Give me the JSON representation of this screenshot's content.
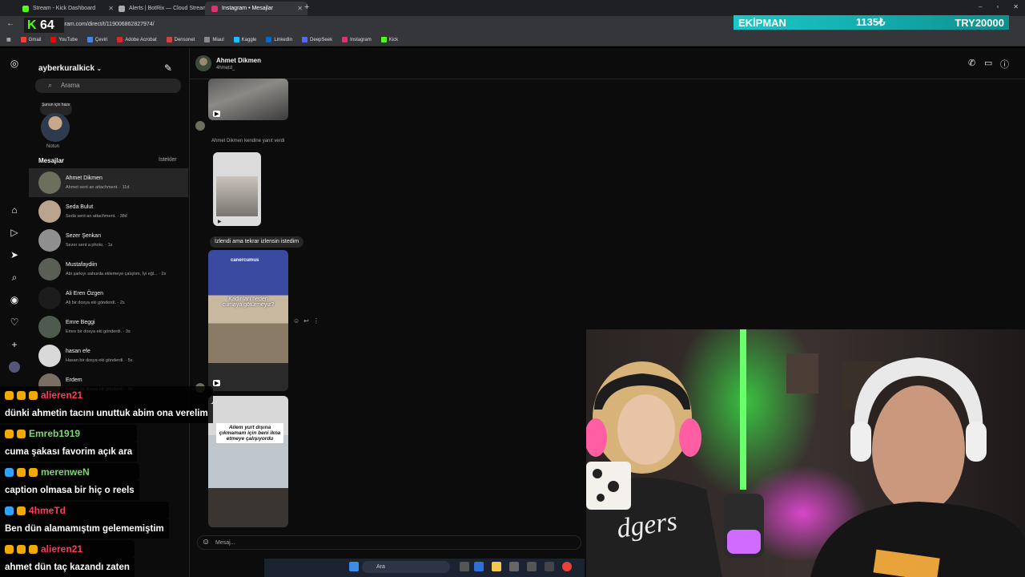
{
  "browser": {
    "tabs": [
      {
        "label": "Stream - Kick Dashboard",
        "color": "#53fc18"
      },
      {
        "label": "Alerts | BotRix — Cloud Stream",
        "color": "#aaaaaa"
      },
      {
        "label": "Instagram • Mesajlar",
        "color": "#e1306c"
      }
    ],
    "url": "instagram.com/direct/t/119006862827974/",
    "bookmarks": [
      "Gmail",
      "YouTube",
      "Çeviri",
      "Adobe Acrobat",
      "Densonet",
      "Miaul",
      "Kaggle",
      "LinkedIn",
      "DeepSeek",
      "Instagram",
      "Kick"
    ],
    "kick_viewers": "64"
  },
  "overlay_bar": {
    "name": "EKİPMAN",
    "amount": "1135₺",
    "goal": "TRY20000"
  },
  "instagram": {
    "username": "ayberkuralkick",
    "search_placeholder": "Arama",
    "note_bubble": "Şunun için hazır",
    "note_label": "Notun",
    "messages_heading": "Mesajlar",
    "requests_link": "İstekler",
    "conversations": [
      {
        "name": "Ahmet Dikmen",
        "preview": "Ahmet sent an attachment. · 11d",
        "active": true,
        "color": "#6b6f5c"
      },
      {
        "name": "Seda Bulut",
        "preview": "Seda sent an attachment. · 38d",
        "active": false,
        "color": "#b9a48e"
      },
      {
        "name": "Sezer Şenkan",
        "preview": "Sezer sent a photo. · 1s",
        "active": false,
        "color": "#8f8f8f"
      },
      {
        "name": "Mustafaydiin",
        "preview": "Abi şarkıyı sahurda eklemeye çalıştım, İyi eğl... · 2s",
        "active": false,
        "color": "#5a5f55"
      },
      {
        "name": "Ali Eren Özgen",
        "preview": "Ali bir dosya eki gönderdi. · 2s",
        "active": false,
        "color": "#1c1c1c"
      },
      {
        "name": "Emre Beggi",
        "preview": "Emre bir dosya eki gönderdi. · 3s",
        "active": false,
        "color": "#4e5a4e"
      },
      {
        "name": "hasan efe",
        "preview": "Hasan bir dosya eki gönderdi. · 5s",
        "active": false,
        "color": "#d9d9d9"
      },
      {
        "name": "Erdem",
        "preview": "Erdem bir dosya eki gönderdi. · 6s",
        "active": false,
        "color": "#7a6f63"
      }
    ],
    "chat": {
      "name": "Ahmet Dikmen",
      "username": "4hmetd_",
      "reply_label": "Ahmet Dikmen kendine yanıt verdi",
      "text_message": "İzlendi ama tekrar izlensin istedim",
      "reel1_user": "canercumus",
      "reel1_caption": "Kadınları neden cumaya götürmeyiz?",
      "reel2_caption": "Ailem yurt dışına çıkmamam için beni ikna etmeye çalışıyordu",
      "input_placeholder": "Mesaj..."
    }
  },
  "taskbar": {
    "search_placeholder": "Ara"
  },
  "chat_overlay": [
    {
      "user": "alieren21",
      "color": "#ff3b5c",
      "message": "dünki ahmetin tacını unuttuk abim ona verelim"
    },
    {
      "user": "Emreb1919",
      "color": "#7dd870",
      "message": "cuma şakası favorim açık ara"
    },
    {
      "user": "merenweN",
      "color": "#7dd870",
      "message": "caption olmasa bir hiç o reels"
    },
    {
      "user": "4hmeTd",
      "color": "#ff3b5c",
      "message": "Ben dün alamamıştım gelememiştim"
    },
    {
      "user": "alieren21",
      "color": "#ff3b5c",
      "message": "ahmet dün taç kazandı zaten"
    }
  ]
}
